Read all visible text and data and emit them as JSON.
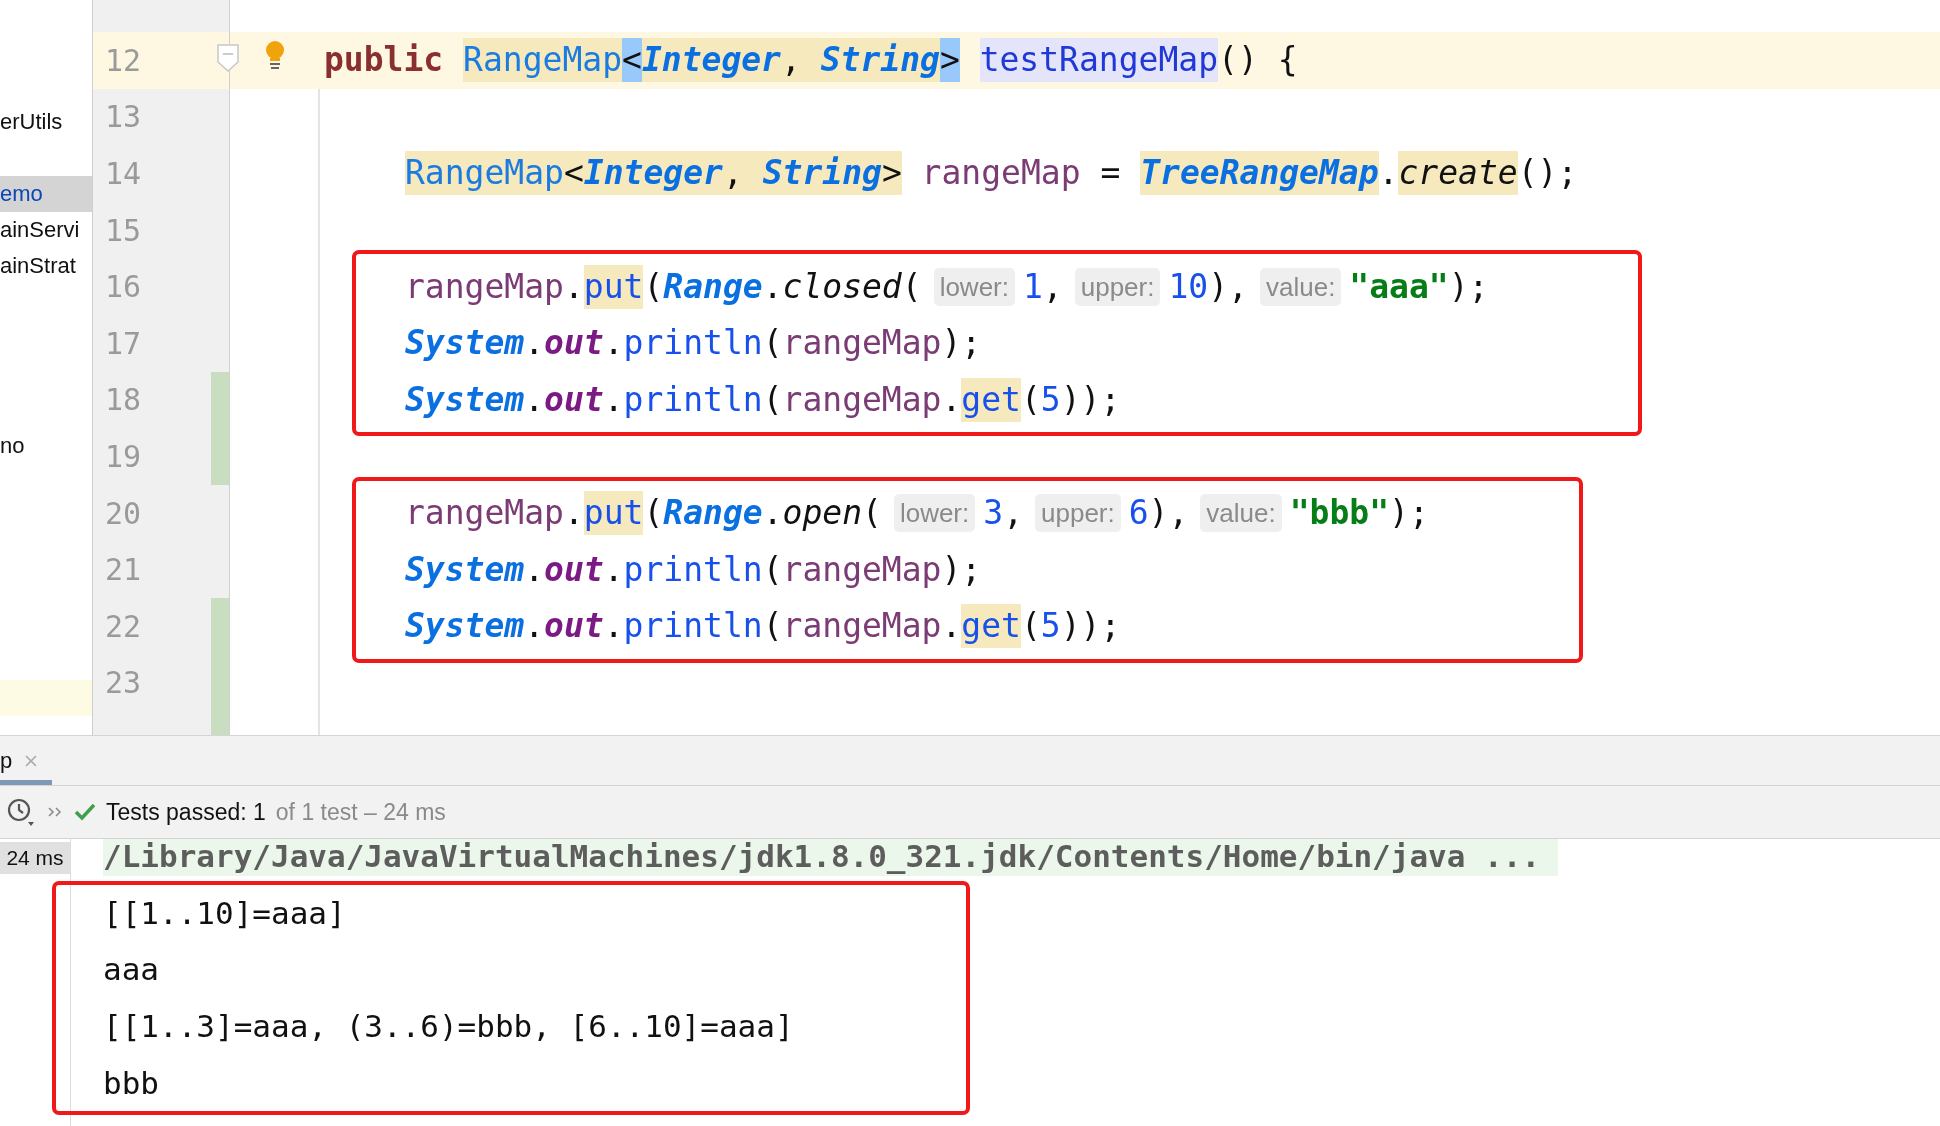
{
  "project_tree": {
    "items": [
      {
        "label": "erUtils",
        "selected": false
      },
      {
        "label": "emo",
        "selected": true
      },
      {
        "label": "ainServi",
        "selected": false
      },
      {
        "label": "ainStrat",
        "selected": false
      },
      {
        "label": "no",
        "selected": false
      }
    ]
  },
  "editor": {
    "lines": [
      {
        "number": "12",
        "current": true,
        "changed": false,
        "indented": false,
        "boxed": false,
        "fold_marker": true,
        "bulb": true,
        "tokens": [
          {
            "text": "public ",
            "kind": "keyword"
          },
          {
            "text": "RangeMap",
            "kind": "type",
            "highlighted": true
          },
          {
            "text": "<",
            "kind": "brace",
            "highlighted": true
          },
          {
            "text": "Integer",
            "kind": "type-italic",
            "highlighted": true
          },
          {
            "text": ", ",
            "kind": "punct",
            "highlighted": true
          },
          {
            "text": "String",
            "kind": "type-italic",
            "highlighted": true
          },
          {
            "text": ">",
            "kind": "brace",
            "highlighted": true
          },
          {
            "text": "testRangeMap",
            "kind": "declaration",
            "highlighted": true,
            "space_before": true
          },
          {
            "text": "() {",
            "kind": "punct"
          }
        ]
      },
      {
        "number": "13",
        "current": false,
        "changed": false,
        "boxed": false
      },
      {
        "number": "14",
        "current": false,
        "changed": false,
        "indented": true,
        "boxed": false,
        "tokens": [
          {
            "text": "RangeMap",
            "kind": "type",
            "highlighted": true
          },
          {
            "text": "<",
            "kind": "punct",
            "highlighted": true
          },
          {
            "text": "Integer",
            "kind": "type-italic",
            "highlighted": true
          },
          {
            "text": ", ",
            "kind": "punct",
            "highlighted": true
          },
          {
            "text": "String",
            "kind": "type-italic",
            "highlighted": true
          },
          {
            "text": ">",
            "kind": "punct",
            "highlighted": true
          },
          {
            "text": " rangeMap",
            "kind": "variable"
          },
          {
            "text": " = ",
            "kind": "punct"
          },
          {
            "text": "TreeRangeMap",
            "kind": "type-italic",
            "highlighted": true
          },
          {
            "text": ".",
            "kind": "punct"
          },
          {
            "text": "create",
            "kind": "method-italic",
            "highlighted": true
          },
          {
            "text": "();",
            "kind": "punct"
          }
        ]
      },
      {
        "number": "15",
        "current": false,
        "changed": false,
        "boxed": false
      },
      {
        "number": "16",
        "current": false,
        "changed": false,
        "indented": true,
        "boxed": true,
        "tokens": [
          {
            "text": "rangeMap",
            "kind": "variable"
          },
          {
            "text": ".",
            "kind": "punct"
          },
          {
            "text": "put",
            "kind": "method",
            "highlighted": true
          },
          {
            "text": "(",
            "kind": "punct"
          },
          {
            "text": "Range",
            "kind": "type-italic"
          },
          {
            "text": ".",
            "kind": "punct"
          },
          {
            "text": "closed",
            "kind": "method-italic"
          },
          {
            "text": "(",
            "kind": "punct"
          },
          {
            "text": "lower:",
            "kind": "hint"
          },
          {
            "text": "1",
            "kind": "number"
          },
          {
            "text": ",",
            "kind": "punct"
          },
          {
            "text": "upper:",
            "kind": "hint"
          },
          {
            "text": "10",
            "kind": "number"
          },
          {
            "text": "),",
            "kind": "punct"
          },
          {
            "text": "value:",
            "kind": "hint"
          },
          {
            "text": "\"aaa\"",
            "kind": "string"
          },
          {
            "text": ");",
            "kind": "punct"
          }
        ]
      },
      {
        "number": "17",
        "current": false,
        "changed": false,
        "indented": true,
        "boxed": true,
        "tokens": [
          {
            "text": "System",
            "kind": "static-class"
          },
          {
            "text": ".",
            "kind": "punct"
          },
          {
            "text": "out",
            "kind": "field"
          },
          {
            "text": ".",
            "kind": "punct"
          },
          {
            "text": "println",
            "kind": "method"
          },
          {
            "text": "(",
            "kind": "punct"
          },
          {
            "text": "rangeMap",
            "kind": "variable"
          },
          {
            "text": ");",
            "kind": "punct"
          }
        ]
      },
      {
        "number": "18",
        "current": false,
        "changed": true,
        "indented": true,
        "boxed": true,
        "tokens": [
          {
            "text": "System",
            "kind": "static-class"
          },
          {
            "text": ".",
            "kind": "punct"
          },
          {
            "text": "out",
            "kind": "field"
          },
          {
            "text": ".",
            "kind": "punct"
          },
          {
            "text": "println",
            "kind": "method"
          },
          {
            "text": "(",
            "kind": "punct"
          },
          {
            "text": "rangeMap",
            "kind": "variable"
          },
          {
            "text": ".",
            "kind": "punct"
          },
          {
            "text": "get",
            "kind": "method",
            "highlighted": true
          },
          {
            "text": "(",
            "kind": "punct"
          },
          {
            "text": "5",
            "kind": "number"
          },
          {
            "text": "));",
            "kind": "punct"
          }
        ]
      },
      {
        "number": "19",
        "current": false,
        "changed": true,
        "boxed": false
      },
      {
        "number": "20",
        "current": false,
        "changed": false,
        "indented": true,
        "boxed": true,
        "tokens": [
          {
            "text": "rangeMap",
            "kind": "variable"
          },
          {
            "text": ".",
            "kind": "punct"
          },
          {
            "text": "put",
            "kind": "method",
            "highlighted": true
          },
          {
            "text": "(",
            "kind": "punct"
          },
          {
            "text": "Range",
            "kind": "type-italic"
          },
          {
            "text": ".",
            "kind": "punct"
          },
          {
            "text": "open",
            "kind": "method-italic"
          },
          {
            "text": "(",
            "kind": "punct"
          },
          {
            "text": "lower:",
            "kind": "hint"
          },
          {
            "text": "3",
            "kind": "number"
          },
          {
            "text": ",",
            "kind": "punct"
          },
          {
            "text": "upper:",
            "kind": "hint"
          },
          {
            "text": "6",
            "kind": "number"
          },
          {
            "text": "),",
            "kind": "punct"
          },
          {
            "text": "value:",
            "kind": "hint"
          },
          {
            "text": "\"bbb\"",
            "kind": "string"
          },
          {
            "text": ");",
            "kind": "punct"
          }
        ]
      },
      {
        "number": "21",
        "current": false,
        "changed": false,
        "indented": true,
        "boxed": true,
        "tokens": [
          {
            "text": "System",
            "kind": "static-class"
          },
          {
            "text": ".",
            "kind": "punct"
          },
          {
            "text": "out",
            "kind": "field"
          },
          {
            "text": ".",
            "kind": "punct"
          },
          {
            "text": "println",
            "kind": "method"
          },
          {
            "text": "(",
            "kind": "punct"
          },
          {
            "text": "rangeMap",
            "kind": "variable"
          },
          {
            "text": ");",
            "kind": "punct"
          }
        ]
      },
      {
        "number": "22",
        "current": false,
        "changed": true,
        "indented": true,
        "boxed": true,
        "tokens": [
          {
            "text": "System",
            "kind": "static-class"
          },
          {
            "text": ".",
            "kind": "punct"
          },
          {
            "text": "out",
            "kind": "field"
          },
          {
            "text": ".",
            "kind": "punct"
          },
          {
            "text": "println",
            "kind": "method"
          },
          {
            "text": "(",
            "kind": "punct"
          },
          {
            "text": "rangeMap",
            "kind": "variable"
          },
          {
            "text": ".",
            "kind": "punct"
          },
          {
            "text": "get",
            "kind": "method",
            "highlighted": true
          },
          {
            "text": "(",
            "kind": "punct"
          },
          {
            "text": "5",
            "kind": "number"
          },
          {
            "text": "));",
            "kind": "punct"
          }
        ]
      },
      {
        "number": "23",
        "current": false,
        "changed": true,
        "boxed": false
      },
      {
        "current": false,
        "changed": true,
        "boxed": false
      }
    ]
  },
  "run_panel": {
    "tabs": [
      {
        "label": "p",
        "selected": true
      }
    ],
    "toolbar": {
      "summary": "Tests passed: 1",
      "detail": "of 1 test – 24 ms"
    },
    "duration": "24 ms",
    "console": [
      {
        "text": "/Library/Java/JavaVirtualMachines/jdk1.8.0_321.jdk/Contents/Home/bin/java ...",
        "kind": "command",
        "boxed": false
      },
      {
        "text": "[[1..10]=aaa]",
        "kind": "output",
        "boxed": true
      },
      {
        "text": "aaa",
        "kind": "output",
        "boxed": true
      },
      {
        "text": "[[1..3]=aaa, (3..6)=bbb, [6..10]=aaa]",
        "kind": "output",
        "boxed": true
      },
      {
        "text": "bbb",
        "kind": "output",
        "boxed": true
      }
    ]
  }
}
